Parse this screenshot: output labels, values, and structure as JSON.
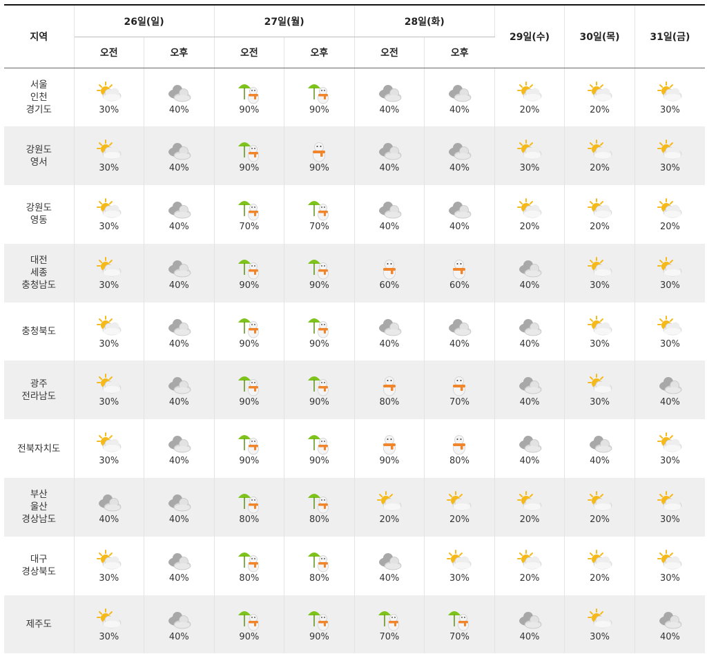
{
  "header": {
    "region_label": "지역",
    "split_days": [
      "26일(일)",
      "27일(월)",
      "28일(화)"
    ],
    "ampm": [
      "오전",
      "오후"
    ],
    "single_days": [
      "29일(수)",
      "30일(목)",
      "31일(금)"
    ]
  },
  "rows": [
    {
      "region": [
        "서울",
        "인천",
        "경기도"
      ],
      "cells": [
        {
          "icon": "partly-cloudy-icon",
          "pct": "30%"
        },
        {
          "icon": "cloudy-icon",
          "pct": "40%"
        },
        {
          "icon": "rain-snow-icon",
          "pct": "90%"
        },
        {
          "icon": "rain-snow-icon",
          "pct": "90%"
        },
        {
          "icon": "cloudy-icon",
          "pct": "40%"
        },
        {
          "icon": "cloudy-icon",
          "pct": "40%"
        },
        {
          "icon": "partly-cloudy-icon",
          "pct": "20%"
        },
        {
          "icon": "partly-cloudy-icon",
          "pct": "20%"
        },
        {
          "icon": "partly-cloudy-icon",
          "pct": "30%"
        }
      ]
    },
    {
      "region": [
        "강원도",
        "영서"
      ],
      "cells": [
        {
          "icon": "partly-cloudy-icon",
          "pct": "30%"
        },
        {
          "icon": "cloudy-icon",
          "pct": "40%"
        },
        {
          "icon": "rain-snow-icon",
          "pct": "90%"
        },
        {
          "icon": "snow-icon",
          "pct": "90%"
        },
        {
          "icon": "cloudy-icon",
          "pct": "40%"
        },
        {
          "icon": "cloudy-icon",
          "pct": "40%"
        },
        {
          "icon": "partly-cloudy-icon",
          "pct": "30%"
        },
        {
          "icon": "partly-cloudy-icon",
          "pct": "20%"
        },
        {
          "icon": "partly-cloudy-icon",
          "pct": "30%"
        }
      ]
    },
    {
      "region": [
        "강원도",
        "영동"
      ],
      "cells": [
        {
          "icon": "partly-cloudy-icon",
          "pct": "30%"
        },
        {
          "icon": "cloudy-icon",
          "pct": "40%"
        },
        {
          "icon": "rain-snow-icon",
          "pct": "70%"
        },
        {
          "icon": "rain-snow-icon",
          "pct": "70%"
        },
        {
          "icon": "cloudy-icon",
          "pct": "40%"
        },
        {
          "icon": "cloudy-icon",
          "pct": "40%"
        },
        {
          "icon": "partly-cloudy-icon",
          "pct": "20%"
        },
        {
          "icon": "partly-cloudy-icon",
          "pct": "20%"
        },
        {
          "icon": "partly-cloudy-icon",
          "pct": "20%"
        }
      ]
    },
    {
      "region": [
        "대전",
        "세종",
        "충청남도"
      ],
      "cells": [
        {
          "icon": "partly-cloudy-icon",
          "pct": "30%"
        },
        {
          "icon": "cloudy-icon",
          "pct": "40%"
        },
        {
          "icon": "rain-snow-icon",
          "pct": "90%"
        },
        {
          "icon": "rain-snow-icon",
          "pct": "90%"
        },
        {
          "icon": "snow-icon",
          "pct": "60%"
        },
        {
          "icon": "snow-icon",
          "pct": "60%"
        },
        {
          "icon": "cloudy-icon",
          "pct": "40%"
        },
        {
          "icon": "partly-cloudy-icon",
          "pct": "30%"
        },
        {
          "icon": "partly-cloudy-icon",
          "pct": "30%"
        }
      ]
    },
    {
      "region": [
        "충청북도"
      ],
      "cells": [
        {
          "icon": "partly-cloudy-icon",
          "pct": "30%"
        },
        {
          "icon": "cloudy-icon",
          "pct": "40%"
        },
        {
          "icon": "rain-snow-icon",
          "pct": "90%"
        },
        {
          "icon": "rain-snow-icon",
          "pct": "90%"
        },
        {
          "icon": "cloudy-icon",
          "pct": "40%"
        },
        {
          "icon": "cloudy-icon",
          "pct": "40%"
        },
        {
          "icon": "cloudy-icon",
          "pct": "40%"
        },
        {
          "icon": "partly-cloudy-icon",
          "pct": "30%"
        },
        {
          "icon": "partly-cloudy-icon",
          "pct": "30%"
        }
      ]
    },
    {
      "region": [
        "광주",
        "전라남도"
      ],
      "cells": [
        {
          "icon": "partly-cloudy-icon",
          "pct": "30%"
        },
        {
          "icon": "cloudy-icon",
          "pct": "40%"
        },
        {
          "icon": "rain-snow-icon",
          "pct": "90%"
        },
        {
          "icon": "rain-snow-icon",
          "pct": "90%"
        },
        {
          "icon": "snow-icon",
          "pct": "80%"
        },
        {
          "icon": "snow-icon",
          "pct": "70%"
        },
        {
          "icon": "cloudy-icon",
          "pct": "40%"
        },
        {
          "icon": "partly-cloudy-icon",
          "pct": "30%"
        },
        {
          "icon": "cloudy-icon",
          "pct": "40%"
        }
      ]
    },
    {
      "region": [
        "전북자치도"
      ],
      "cells": [
        {
          "icon": "partly-cloudy-icon",
          "pct": "30%"
        },
        {
          "icon": "cloudy-icon",
          "pct": "40%"
        },
        {
          "icon": "rain-snow-icon",
          "pct": "90%"
        },
        {
          "icon": "rain-snow-icon",
          "pct": "90%"
        },
        {
          "icon": "snow-icon",
          "pct": "90%"
        },
        {
          "icon": "snow-icon",
          "pct": "80%"
        },
        {
          "icon": "cloudy-icon",
          "pct": "40%"
        },
        {
          "icon": "cloudy-icon",
          "pct": "40%"
        },
        {
          "icon": "partly-cloudy-icon",
          "pct": "30%"
        }
      ]
    },
    {
      "region": [
        "부산",
        "울산",
        "경상남도"
      ],
      "cells": [
        {
          "icon": "cloudy-icon",
          "pct": "40%"
        },
        {
          "icon": "cloudy-icon",
          "pct": "40%"
        },
        {
          "icon": "rain-snow-icon",
          "pct": "80%"
        },
        {
          "icon": "rain-snow-icon",
          "pct": "80%"
        },
        {
          "icon": "partly-cloudy-icon",
          "pct": "20%"
        },
        {
          "icon": "partly-cloudy-icon",
          "pct": "20%"
        },
        {
          "icon": "partly-cloudy-icon",
          "pct": "20%"
        },
        {
          "icon": "partly-cloudy-icon",
          "pct": "20%"
        },
        {
          "icon": "partly-cloudy-icon",
          "pct": "30%"
        }
      ]
    },
    {
      "region": [
        "대구",
        "경상북도"
      ],
      "cells": [
        {
          "icon": "partly-cloudy-icon",
          "pct": "30%"
        },
        {
          "icon": "cloudy-icon",
          "pct": "40%"
        },
        {
          "icon": "rain-snow-icon",
          "pct": "80%"
        },
        {
          "icon": "rain-snow-icon",
          "pct": "80%"
        },
        {
          "icon": "cloudy-icon",
          "pct": "40%"
        },
        {
          "icon": "partly-cloudy-icon",
          "pct": "30%"
        },
        {
          "icon": "partly-cloudy-icon",
          "pct": "20%"
        },
        {
          "icon": "partly-cloudy-icon",
          "pct": "20%"
        },
        {
          "icon": "partly-cloudy-icon",
          "pct": "30%"
        }
      ]
    },
    {
      "region": [
        "제주도"
      ],
      "cells": [
        {
          "icon": "partly-cloudy-icon",
          "pct": "30%"
        },
        {
          "icon": "cloudy-icon",
          "pct": "40%"
        },
        {
          "icon": "rain-snow-icon",
          "pct": "90%"
        },
        {
          "icon": "rain-snow-icon",
          "pct": "90%"
        },
        {
          "icon": "rain-snow-icon",
          "pct": "70%"
        },
        {
          "icon": "rain-snow-icon",
          "pct": "70%"
        },
        {
          "icon": "cloudy-icon",
          "pct": "40%"
        },
        {
          "icon": "partly-cloudy-icon",
          "pct": "30%"
        },
        {
          "icon": "cloudy-icon",
          "pct": "40%"
        }
      ]
    }
  ],
  "colors": {
    "sun": "#f6b91a",
    "cloud_light": "#eeeeee",
    "cloud_dark": "#a8a8a8",
    "umbrella": "#7ec21c",
    "scarf": "#f0852c",
    "row_alt_bg": "#efefef"
  }
}
